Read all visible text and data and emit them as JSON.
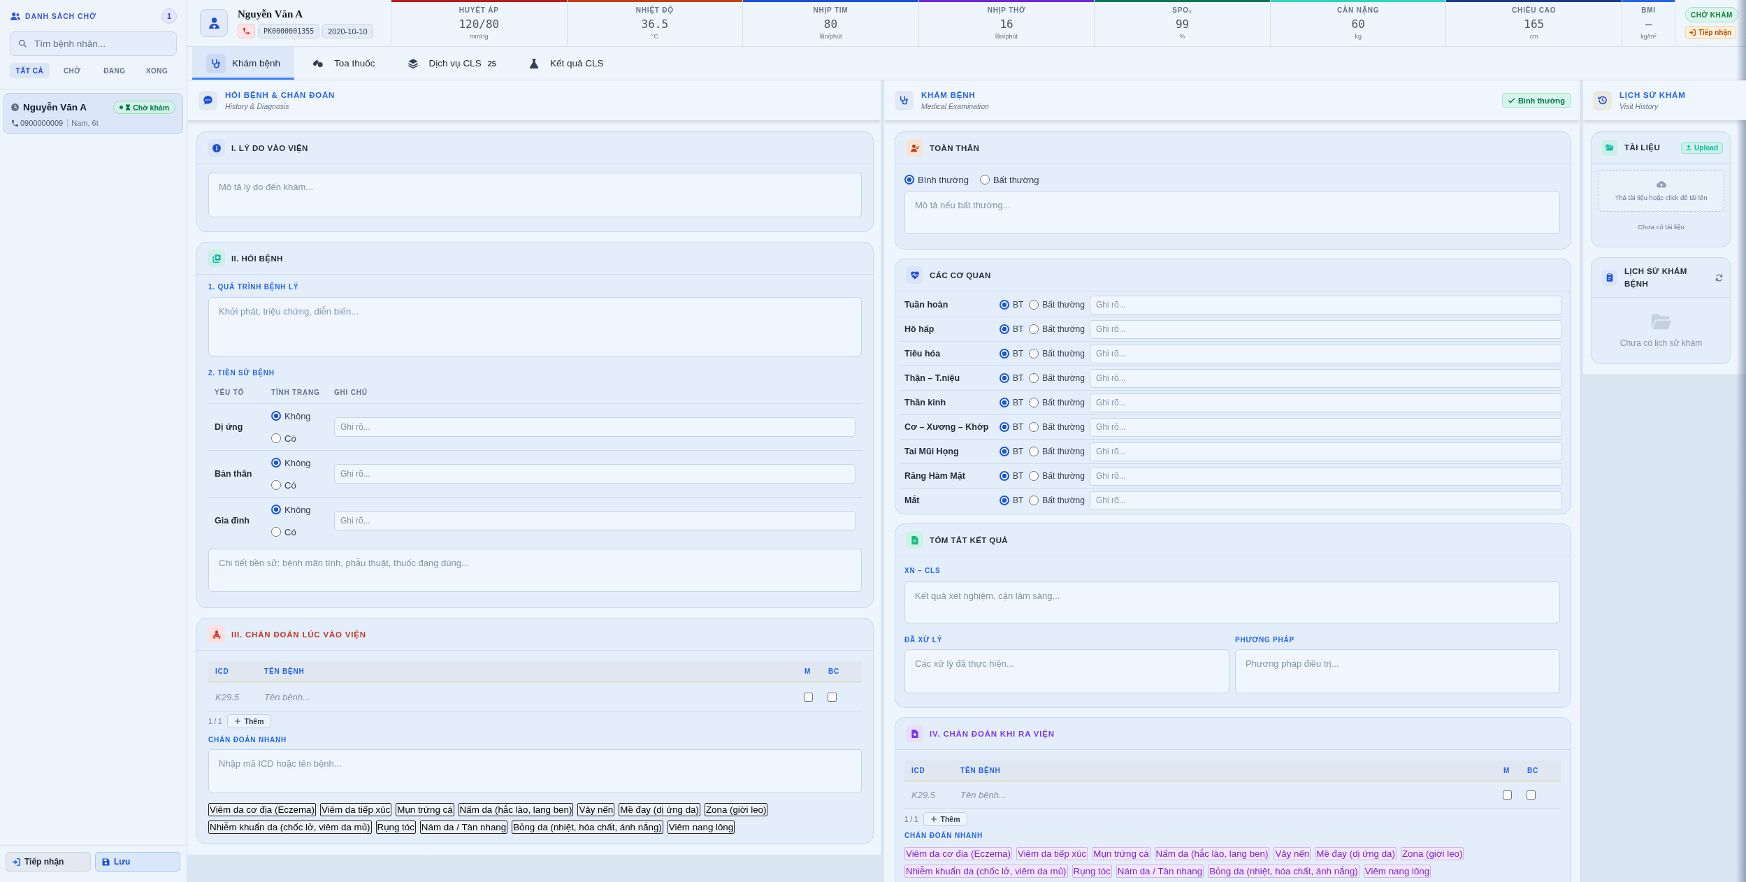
{
  "sidebar": {
    "title": "DANH SÁCH CHỜ",
    "count": "1",
    "search": {
      "placeholder": "Tìm bệnh nhân..."
    },
    "filters": [
      {
        "label": "TẤT CẢ",
        "selected": true
      },
      {
        "label": "CHỜ",
        "selected": false
      },
      {
        "label": "ĐANG",
        "selected": false
      },
      {
        "label": "XONG",
        "selected": false
      }
    ],
    "patients": [
      {
        "name": "Nguyễn Văn A",
        "status": "Chờ khám",
        "phone": "0900000009",
        "info": "Nam, 6t",
        "selected": true
      }
    ],
    "actions": [
      {
        "label": "Tiếp nhận",
        "kind": "receive"
      },
      {
        "label": "Lưu",
        "kind": "save"
      }
    ]
  },
  "patient": {
    "name": "Nguyễn Văn A",
    "code": "PK0000001355",
    "date": "2020-10-10"
  },
  "vitals": [
    {
      "label": "HUYẾT ÁP",
      "value": "120/80",
      "unit": "mmHg",
      "color": "#b91c1c"
    },
    {
      "label": "NHIỆT ĐỘ",
      "value": "36.5",
      "unit": "°C",
      "color": "#c2410c"
    },
    {
      "label": "NHỊP TIM",
      "value": "80",
      "unit": "lần/phút",
      "color": "#1d4ed8"
    },
    {
      "label": "NHỊP THỞ",
      "value": "16",
      "unit": "lần/phút",
      "color": "#6d28d9"
    },
    {
      "label": "SPO₂",
      "value": "99",
      "unit": "%",
      "color": "#047857"
    },
    {
      "label": "CÂN NẶNG",
      "value": "60",
      "unit": "kg",
      "color": "#2dd4bf"
    },
    {
      "label": "CHIỀU CAO",
      "value": "165",
      "unit": "cm",
      "color": "#1e3a8a"
    },
    {
      "label": "BMI",
      "value": "–",
      "unit": "kg/m²",
      "color": "#2563eb"
    }
  ],
  "status": {
    "badge": "CHỜ KHÁM",
    "button": "Tiếp nhận"
  },
  "tabs": [
    {
      "label": "Khám bệnh",
      "selected": true
    },
    {
      "label": "Toa thuốc",
      "selected": false
    },
    {
      "label": "Dịch vụ CLS",
      "count": "25",
      "selected": false
    },
    {
      "label": "Kết quả CLS",
      "selected": false
    }
  ],
  "history_panel": {
    "title": "HỎI BỆNH & CHẨN ĐOÁN",
    "subtitle": "History & Diagnosis",
    "reason": {
      "title": "I. LÝ DO VÀO VIỆN",
      "placeholder": "Mô tả lý do đến khám..."
    },
    "inquiry": {
      "title": "II. HỎI BỆNH",
      "course_label": "1. QUÁ TRÌNH BỆNH LÝ",
      "course_placeholder": "Khởi phát, triệu chứng, diễn biến...",
      "past_label": "2. TIỀN SỬ BỆNH",
      "columns": [
        "YẾU TỐ",
        "TÌNH TRẠNG",
        "GHI CHÚ"
      ],
      "rows": [
        {
          "factor": "Dị ứng",
          "options": [
            {
              "label": "Không",
              "selected": true
            },
            {
              "label": "Có",
              "selected": false
            }
          ],
          "placeholder": "Ghi rõ..."
        },
        {
          "factor": "Bản thân",
          "options": [
            {
              "label": "Không",
              "selected": true
            },
            {
              "label": "Có",
              "selected": false
            }
          ],
          "placeholder": "Ghi rõ..."
        },
        {
          "factor": "Gia đình",
          "options": [
            {
              "label": "Không",
              "selected": true
            },
            {
              "label": "Có",
              "selected": false
            }
          ],
          "placeholder": "Ghi rõ..."
        }
      ],
      "detail_placeholder": "Chi tiết tiền sử: bệnh mãn tính, phẫu thuật, thuốc đang dùng..."
    },
    "admission_diagnosis": {
      "title": "III. CHẨN ĐOÁN LÚC VÀO VIỆN",
      "columns": [
        "ICD",
        "TÊN BỆNH",
        "M",
        "BC"
      ],
      "rows": [
        {
          "icd_placeholder": "K29.5",
          "name_placeholder": "Tên bệnh...",
          "m_checked": false,
          "bc_checked": false
        }
      ],
      "pager": "1 / 1",
      "add_button": "Thêm",
      "quick_label": "CHẨN ĐOÁN NHANH",
      "quick_placeholder": "Nhập mã ICD hoặc tên bệnh...",
      "quick_chips": [
        "Viêm da cơ địa (Eczema)",
        "Viêm da tiếp xúc",
        "Mụn trứng cá",
        "Nấm da (hắc lào, lang ben)",
        "Vảy nến",
        "Mề đay (dị ứng da)",
        "Zona (giời leo)",
        "Nhiễm khuẩn da (chốc lở, viêm da mủ)",
        "Rụng tóc",
        "Nám da / Tàn nhang",
        "Bỏng da (nhiệt, hóa chất, ánh nắng)",
        "Viêm nang lông"
      ]
    }
  },
  "exam_panel": {
    "title": "KHÁM BỆNH",
    "subtitle": "Medical Examination",
    "badge": "Bình thường",
    "general": {
      "title": "TOÀN THÂN",
      "options": [
        {
          "label": "Bình thường",
          "selected": true
        },
        {
          "label": "Bất thường",
          "selected": false
        }
      ],
      "placeholder": "Mô tả nếu bất thường..."
    },
    "organs": {
      "title": "CÁC CƠ QUAN",
      "rows": [
        {
          "name": "Tuần hoàn",
          "options": [
            {
              "label": "BT",
              "selected": true
            },
            {
              "label": "Bất thường",
              "selected": false
            }
          ],
          "placeholder": "Ghi rõ..."
        },
        {
          "name": "Hô hấp",
          "options": [
            {
              "label": "BT",
              "selected": true
            },
            {
              "label": "Bất thường",
              "selected": false
            }
          ],
          "placeholder": "Ghi rõ..."
        },
        {
          "name": "Tiêu hóa",
          "options": [
            {
              "label": "BT",
              "selected": true
            },
            {
              "label": "Bất thường",
              "selected": false
            }
          ],
          "placeholder": "Ghi rõ..."
        },
        {
          "name": "Thận – T.niệu",
          "options": [
            {
              "label": "BT",
              "selected": true
            },
            {
              "label": "Bất thường",
              "selected": false
            }
          ],
          "placeholder": "Ghi rõ..."
        },
        {
          "name": "Thần kinh",
          "options": [
            {
              "label": "BT",
              "selected": true
            },
            {
              "label": "Bất thường",
              "selected": false
            }
          ],
          "placeholder": "Ghi rõ..."
        },
        {
          "name": "Cơ – Xương – Khớp",
          "options": [
            {
              "label": "BT",
              "selected": true
            },
            {
              "label": "Bất thường",
              "selected": false
            }
          ],
          "placeholder": "Ghi rõ..."
        },
        {
          "name": "Tai Mũi Họng",
          "options": [
            {
              "label": "BT",
              "selected": true
            },
            {
              "label": "Bất thường",
              "selected": false
            }
          ],
          "placeholder": "Ghi rõ..."
        },
        {
          "name": "Răng Hàm Mặt",
          "options": [
            {
              "label": "BT",
              "selected": true
            },
            {
              "label": "Bất thường",
              "selected": false
            }
          ],
          "placeholder": "Ghi rõ..."
        },
        {
          "name": "Mắt",
          "options": [
            {
              "label": "BT",
              "selected": true
            },
            {
              "label": "Bất thường",
              "selected": false
            }
          ],
          "placeholder": "Ghi rõ..."
        }
      ]
    },
    "summary": {
      "title": "TÓM TẮT KẾT QUẢ",
      "tests": {
        "label": "XN – CLS",
        "placeholder": "Kết quả xét nghiệm, cận lâm sàng..."
      },
      "treatments": [
        {
          "label": "ĐÃ XỬ LÝ",
          "placeholder": "Các xử lý đã thực hiện..."
        },
        {
          "label": "PHƯƠNG PHÁP",
          "placeholder": "Phương pháp điều trị..."
        }
      ]
    },
    "discharge_diagnosis": {
      "title": "IV. CHẨN ĐOÁN KHI RA VIỆN",
      "columns": [
        "ICD",
        "TÊN BỆNH",
        "M",
        "BC"
      ],
      "rows": [
        {
          "icd_placeholder": "K29.5",
          "name_placeholder": "Tên bệnh...",
          "m_checked": false,
          "bc_checked": false
        }
      ],
      "pager": "1 / 1",
      "add_button": "Thêm",
      "quick_label": "CHẨN ĐOÁN NHANH",
      "quick_chips": [
        "Viêm da cơ địa (Eczema)",
        "Viêm da tiếp xúc",
        "Mụn trứng cá",
        "Nấm da (hắc lào, lang ben)",
        "Vảy nến",
        "Mề đay (dị ứng da)",
        "Zona (giời leo)",
        "Nhiễm khuẩn da (chốc lở, viêm da mủ)",
        "Rụng tóc",
        "Nám da / Tàn nhang",
        "Bỏng da (nhiệt, hóa chất, ánh nắng)",
        "Viêm nang lông"
      ]
    }
  },
  "visit_panel": {
    "title": "LỊCH SỬ KHÁM",
    "subtitle": "Visit History",
    "documents": {
      "title": "TÀI LIỆU",
      "upload_button": "Upload",
      "dropzone": "Thả tài liệu hoặc click để tải lên",
      "empty": "Chưa có tài liệu"
    },
    "visits": {
      "title": "LỊCH SỬ KHÁM BỆNH",
      "empty": "Chưa có lịch sử khám"
    }
  }
}
